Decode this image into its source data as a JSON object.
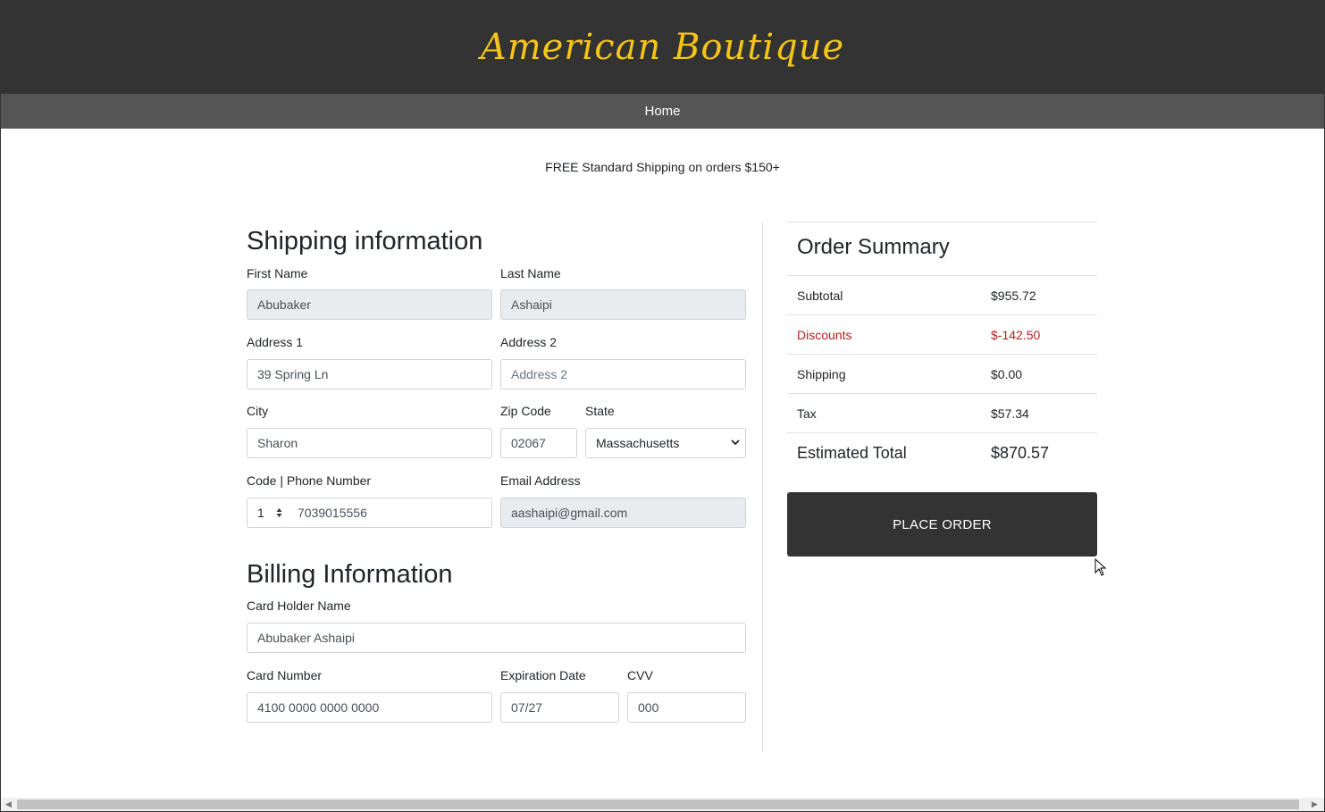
{
  "header": {
    "brand": "American Boutique"
  },
  "nav": {
    "home": "Home"
  },
  "promo": "FREE Standard Shipping on orders $150+",
  "shipping": {
    "title": "Shipping information",
    "first_name": {
      "label": "First Name",
      "value": "Abubaker"
    },
    "last_name": {
      "label": "Last Name",
      "value": "Ashaipi"
    },
    "address1": {
      "label": "Address 1",
      "value": "39 Spring Ln"
    },
    "address2": {
      "label": "Address 2",
      "placeholder": "Address 2"
    },
    "city": {
      "label": "City",
      "value": "Sharon"
    },
    "zip": {
      "label": "Zip Code",
      "value": "02067"
    },
    "state": {
      "label": "State",
      "value": "Massachusetts"
    },
    "phone": {
      "label": "Code | Phone Number",
      "code": "1",
      "value": "7039015556"
    },
    "email": {
      "label": "Email Address",
      "value": "aashaipi@gmail.com"
    }
  },
  "billing": {
    "title": "Billing Information",
    "holder": {
      "label": "Card Holder Name",
      "value": "Abubaker Ashaipi"
    },
    "card_number": {
      "label": "Card Number",
      "value": "4100 0000 0000 0000"
    },
    "expiration": {
      "label": "Expiration Date",
      "value": "07/27"
    },
    "cvv": {
      "label": "CVV",
      "value": "000"
    }
  },
  "summary": {
    "title": "Order Summary",
    "subtotal": {
      "label": "Subtotal",
      "value": "$955.72"
    },
    "discounts": {
      "label": "Discounts",
      "value": "$-142.50"
    },
    "shipping": {
      "label": "Shipping",
      "value": "$0.00"
    },
    "tax": {
      "label": "Tax",
      "value": "$57.34"
    },
    "total": {
      "label": "Estimated Total",
      "value": "$870.57"
    },
    "place_order": "PLACE ORDER"
  },
  "colors": {
    "header_bg": "#333333",
    "brand": "#f5c518",
    "nav_bg": "#555555",
    "discount": "#b71c1c"
  }
}
